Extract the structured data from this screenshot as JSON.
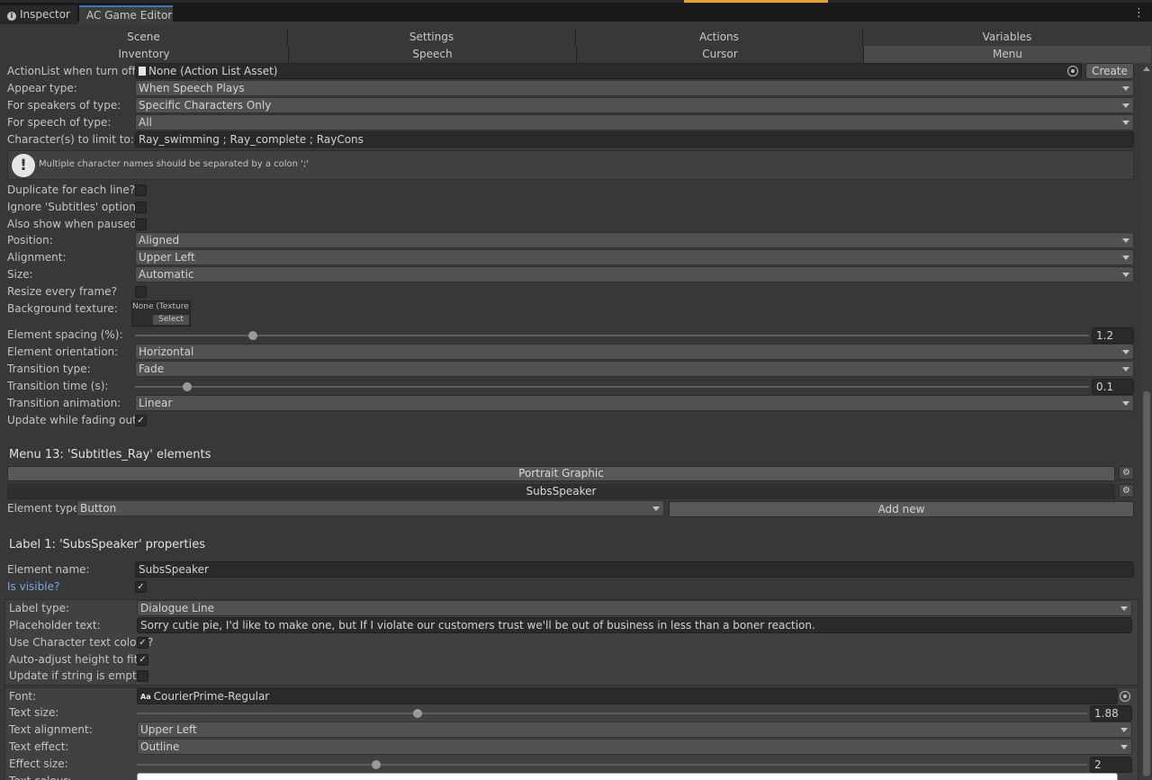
{
  "tabs": {
    "inspector": "Inspector",
    "game_editor": "AC Game Editor",
    "more": "⋮"
  },
  "nav": {
    "row1": [
      "Scene",
      "Settings",
      "Actions",
      "Variables"
    ],
    "row2": [
      "Inventory",
      "Speech",
      "Cursor",
      "Menu"
    ],
    "selected": "Menu"
  },
  "settings": {
    "actionlist_label": "ActionList when turn off:",
    "actionlist_value": "None (Action List Asset)",
    "create_label": "Create",
    "appear_type_label": "Appear type:",
    "appear_type_value": "When Speech Plays",
    "speakers_label": "For speakers of type:",
    "speakers_value": "Specific Characters Only",
    "speech_type_label": "For speech of type:",
    "speech_type_value": "All",
    "characters_label": "Character(s) to limit to:",
    "characters_value": "Ray_swimming ; Ray_complete ; RayCons",
    "help_text": "Multiple character names should be separated by a colon ';'",
    "duplicate_label": "Duplicate for each line?",
    "duplicate_checked": false,
    "ignore_subtitles_label": "Ignore 'Subtitles' option?",
    "ignore_subtitles_checked": false,
    "show_paused_label": "Also show when paused?",
    "show_paused_checked": false,
    "position_label": "Position:",
    "position_value": "Aligned",
    "alignment_label": "Alignment:",
    "alignment_value": "Upper Left",
    "size_label": "Size:",
    "size_value": "Automatic",
    "resize_label": "Resize every frame?",
    "resize_checked": false,
    "bg_texture_label": "Background texture:",
    "bg_texture_value": "None (Texture",
    "bg_texture_select": "Select",
    "spacing_label": "Element spacing (%):",
    "spacing_value": "1.2",
    "orientation_label": "Element orientation:",
    "orientation_value": "Horizontal",
    "transition_type_label": "Transition type:",
    "transition_type_value": "Fade",
    "transition_time_label": "Transition time (s):",
    "transition_time_value": "0.1",
    "transition_anim_label": "Transition animation:",
    "transition_anim_value": "Linear",
    "update_fading_label": "Update while fading out?",
    "update_fading_checked": true
  },
  "elements": {
    "title": "Menu 13: 'Subtitles_Ray' elements",
    "items": [
      "Portrait Graphic",
      "SubsSpeaker"
    ],
    "type_label": "Element type:",
    "type_value": "Button",
    "add_new": "Add new"
  },
  "properties": {
    "title": "Label 1: 'SubsSpeaker' properties",
    "name_label": "Element name:",
    "name_value": "SubsSpeaker",
    "visible_label": "Is visible?",
    "visible_checked": true,
    "label_type_label": "Label type:",
    "label_type_value": "Dialogue Line",
    "placeholder_label": "Placeholder text:",
    "placeholder_value": "Sorry cutie pie, I'd like to make one, but If I violate our customers trust we'll be out of business in less than a boner reaction.",
    "char_colour_label": "Use Character text colour?",
    "char_colour_checked": true,
    "auto_height_label": "Auto-adjust height to fit?",
    "auto_height_checked": true,
    "update_empty_label": "Update if string is empty?",
    "update_empty_checked": false,
    "font_label": "Font:",
    "font_value": "CourierPrime-Regular",
    "text_size_label": "Text size:",
    "text_size_value": "1.88",
    "text_align_label": "Text alignment:",
    "text_align_value": "Upper Left",
    "text_effect_label": "Text effect:",
    "text_effect_value": "Outline",
    "effect_size_label": "Effect size:",
    "effect_size_value": "2",
    "text_colour_label": "Text colour:"
  }
}
